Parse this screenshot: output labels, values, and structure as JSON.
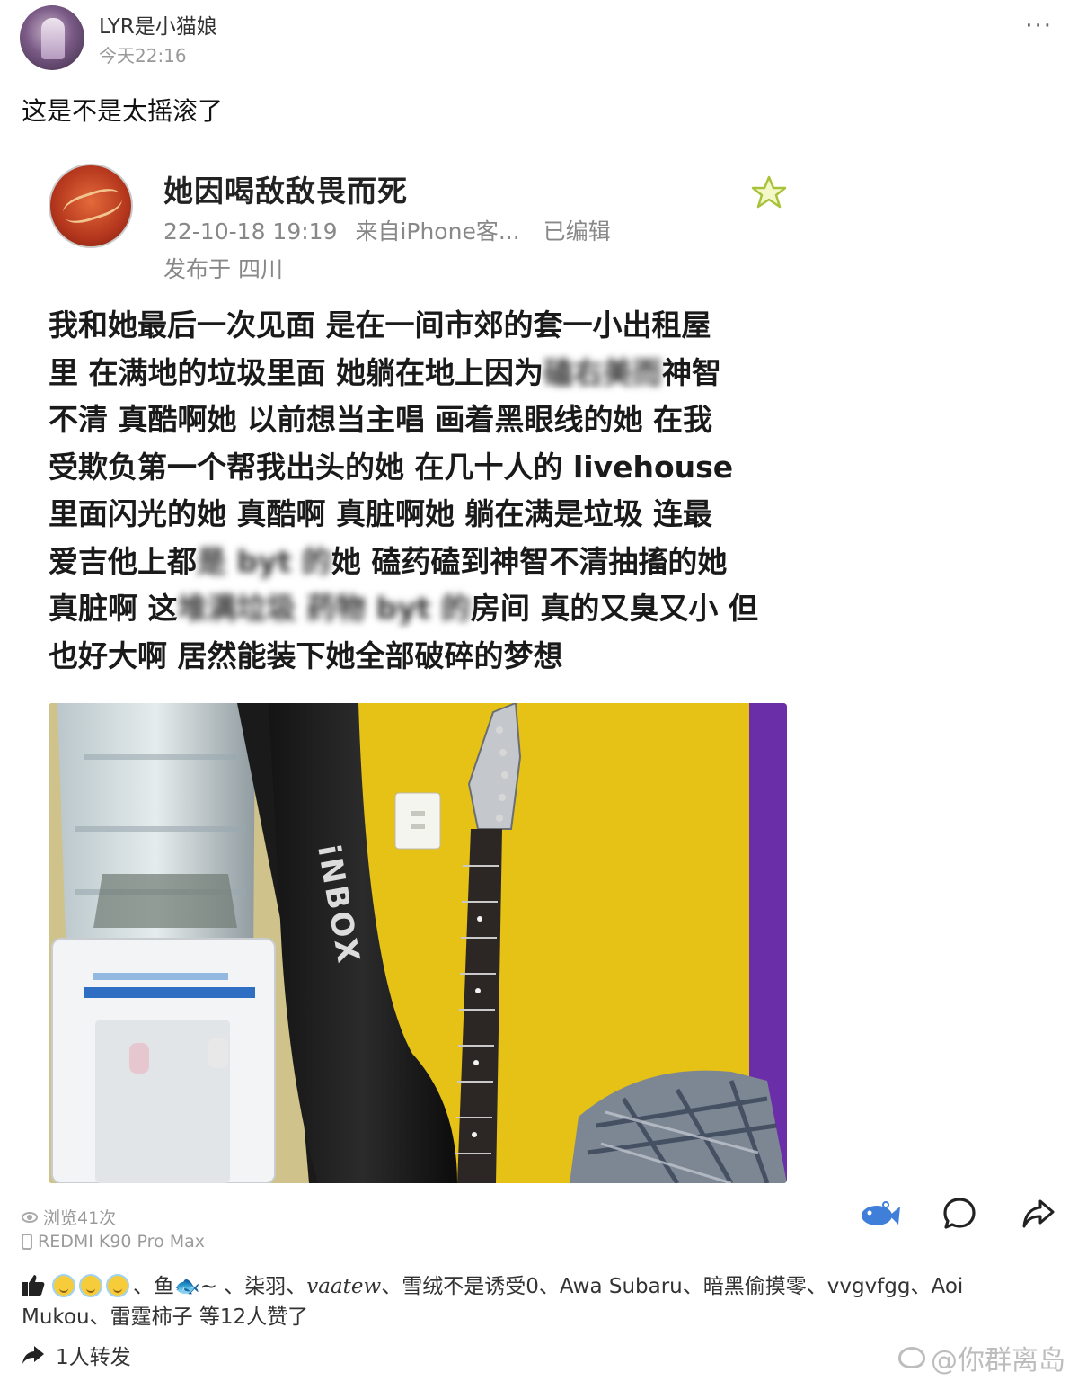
{
  "post": {
    "username": "LYR是小猫娘",
    "time": "今天22:16",
    "caption": "这是不是太摇滚了",
    "more_icon": "···"
  },
  "quoted": {
    "name": "她因喝敌敌畏而死",
    "date": "22-10-18 19:19",
    "source": "来自iPhone客...",
    "edited": "已编辑",
    "location": "发布于 四川",
    "body_lines": [
      [
        "我和她最后一次见面 是在一间市郊的套一小出租屋",
        "",
        ""
      ],
      [
        "里 在满地的垃圾里面 她躺在地上因为",
        "磕右美而",
        "神智"
      ],
      [
        "不清 真酷啊她 以前想当主唱 画着黑眼线的她 在我",
        "",
        ""
      ],
      [
        "受欺负第一个帮我出头的她 在几十人的 livehouse",
        "",
        ""
      ],
      [
        "里面闪光的她 真酷啊 真脏啊她 躺在满是垃圾 连最",
        "",
        ""
      ],
      [
        "爱吉他上都",
        "是 byt 的",
        "她 磕药磕到神智不清抽搐的她"
      ],
      [
        "真脏啊 这",
        "堆满垃圾 药物 byt 的",
        "房间 真的又臭又小 但"
      ],
      [
        "也好大啊 居然能装下她全部破碎的梦想",
        "",
        ""
      ]
    ],
    "photo_label": "iNBOX"
  },
  "footer": {
    "views": "浏览41次",
    "device": "REDMI K90 Pro Max",
    "likes_names": "、鱼",
    "likes_rest_1": "~ 、柒羽、",
    "likes_script": "vaatew",
    "likes_rest_2": "、雪绒不是诱受0、Awa Subaru、暗黑偷摸零、vvgvfgg、Aoi Mukou、雷霆柿子 等12人赞了",
    "reposts": "1人转发",
    "watermark": "@你群离岛"
  },
  "colors": {
    "wall_yellow": "#e8c414",
    "wall_purple": "#6a2fa8",
    "accent_blue": "#3f7fd9"
  }
}
